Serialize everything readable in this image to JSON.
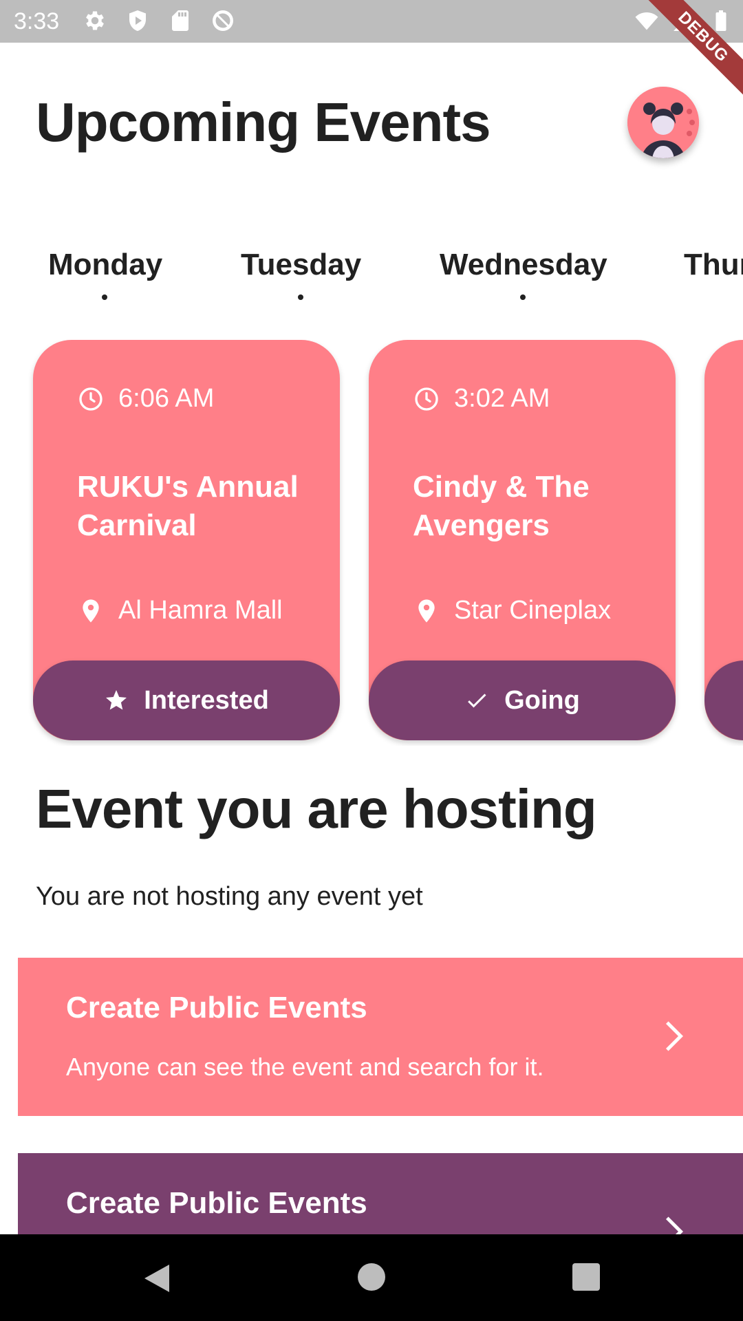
{
  "status_bar": {
    "time": "3:33",
    "left_icons": [
      "settings-icon",
      "shield-icon",
      "sd-card-icon",
      "at-sign-icon"
    ],
    "right_icons": [
      "wifi-icon",
      "signal-icon",
      "battery-icon"
    ]
  },
  "debug_banner": "DEBUG",
  "header": {
    "title": "Upcoming Events",
    "avatar_icon": "user-avatar-icon"
  },
  "day_tabs": [
    {
      "label": "Monday",
      "has_dot": true
    },
    {
      "label": "Tuesday",
      "has_dot": true
    },
    {
      "label": "Wednesday",
      "has_dot": true
    },
    {
      "label": "Thur",
      "has_dot": false
    }
  ],
  "events": [
    {
      "time": "6:06 AM",
      "title": "RUKU's Annual Carnival",
      "location": "Al Hamra Mall",
      "action_label": "Interested",
      "action_icon": "star-icon"
    },
    {
      "time": "3:02 AM",
      "title": "Cindy & The Avengers",
      "location": "Star Cineplax",
      "action_label": "Going",
      "action_icon": "check-icon"
    }
  ],
  "hosting": {
    "title": "Event you are hosting",
    "empty_message": "You are not hosting any event yet"
  },
  "create_options": [
    {
      "title": "Create Public Events",
      "description": "Anyone can see the event and search for it.",
      "icon": "chevron-right-icon"
    },
    {
      "title": "Create Public Events",
      "description": "",
      "icon": "chevron-right-icon"
    }
  ],
  "colors": {
    "card_pink": "#ff7f88",
    "action_purple": "#7a406e",
    "text_dark": "#212121"
  },
  "nav_bar": {
    "icons": [
      "back-icon",
      "home-icon",
      "recents-icon"
    ]
  }
}
